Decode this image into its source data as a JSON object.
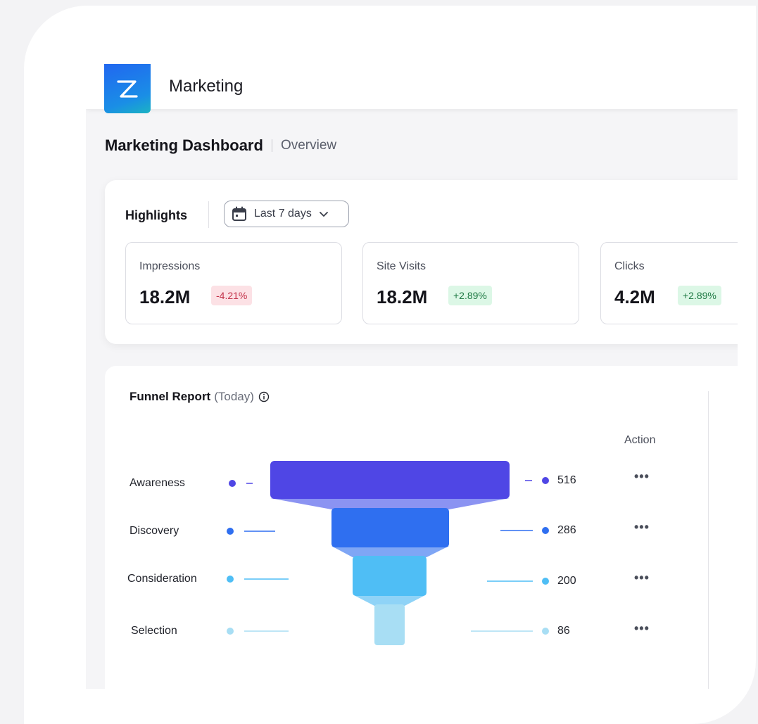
{
  "app": {
    "title": "Marketing",
    "logo_letter": "Z"
  },
  "page": {
    "title": "Marketing Dashboard",
    "subtitle": "Overview"
  },
  "highlights": {
    "label": "Highlights",
    "date_range": "Last 7 days",
    "icons": {
      "date": "calendar-icon",
      "dropdown": "chevron-down-icon"
    },
    "metrics": [
      {
        "label": "Impressions",
        "value": "18.2M",
        "change": "-4.21%",
        "trend": "negative"
      },
      {
        "label": "Site Visits",
        "value": "18.2M",
        "change": "+2.89%",
        "trend": "positive"
      },
      {
        "label": "Clicks",
        "value": "4.2M",
        "change": "+2.89%",
        "trend": "positive"
      }
    ]
  },
  "funnel": {
    "title": "Funnel Report",
    "period": "(Today)",
    "action_header": "Action",
    "action_glyph": "•••",
    "stages": [
      {
        "label": "Awareness",
        "value": "516",
        "color": "#4f46e5"
      },
      {
        "label": "Discovery",
        "value": "286",
        "color": "#2f6ff0"
      },
      {
        "label": "Consideration",
        "value": "200",
        "color": "#4fbef5"
      },
      {
        "label": "Selection",
        "value": "86",
        "color": "#a8def4"
      }
    ]
  },
  "colors": {
    "brand": "#2167f0",
    "negative_badge": "#fce1e5",
    "positive_badge": "#dcf7e6"
  }
}
